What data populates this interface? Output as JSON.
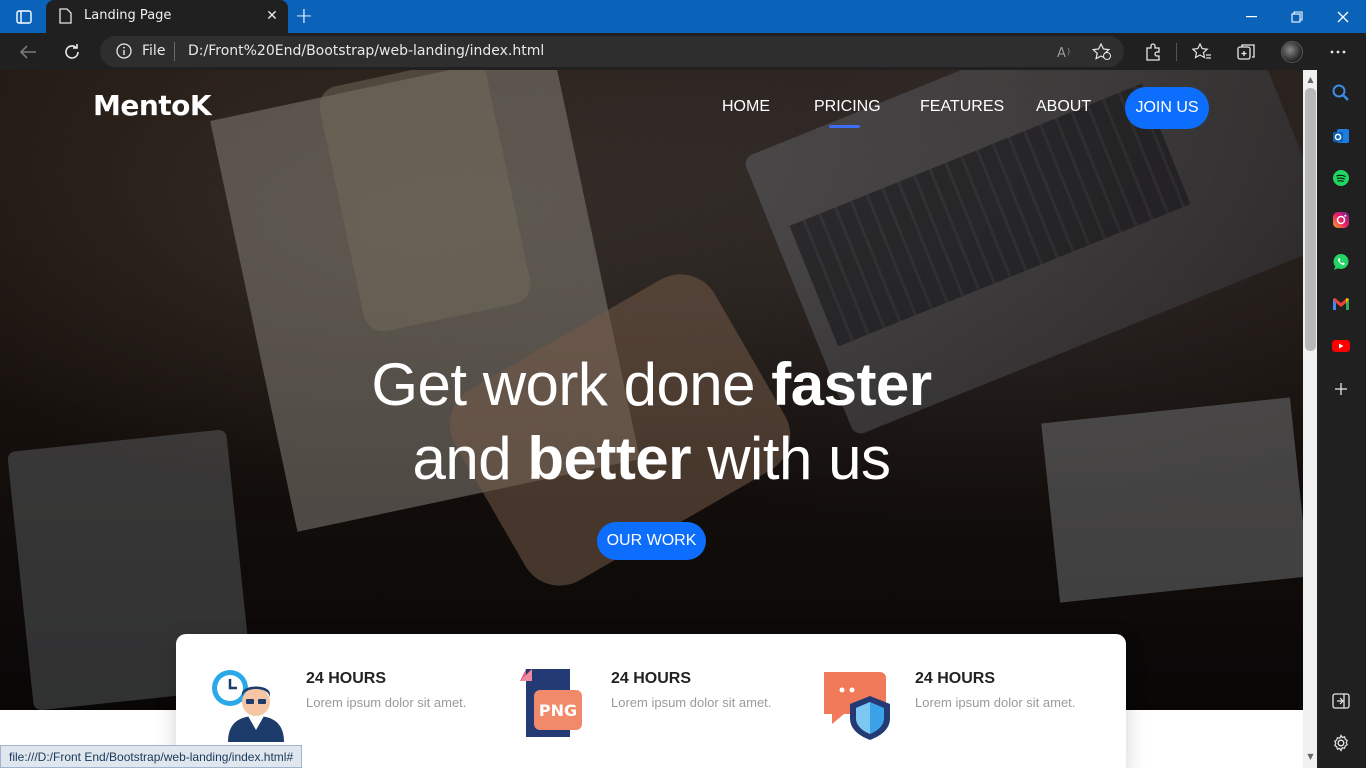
{
  "browser": {
    "tab_title": "Landing Page",
    "file_label": "File",
    "url": "D:/Front%20End/Bootstrap/web-landing/index.html",
    "status_url": "file:///D:/Front End/Bootstrap/web-landing/index.html#"
  },
  "site": {
    "logo": "MentoK",
    "nav": [
      "HOME",
      "PRICING",
      "FEATURES",
      "ABOUT"
    ],
    "active_nav": "PRICING",
    "join_label": "JOIN US",
    "headline": {
      "line1_light": "Get work done ",
      "line1_bold": "faster",
      "line2_light_a": "and ",
      "line2_bold": "better",
      "line2_light_b": " with us"
    },
    "cta_label": "OUR WORK",
    "features": [
      {
        "title": "24 HOURS",
        "text": "Lorem ipsum dolor sit amet.",
        "icon": "support-agent-icon"
      },
      {
        "title": "24 HOURS",
        "text": "Lorem ipsum dolor sit amet.",
        "icon": "png-file-icon",
        "badge": "PNG"
      },
      {
        "title": "24 HOURS",
        "text": "Lorem ipsum dolor sit amet.",
        "icon": "chat-shield-icon"
      }
    ]
  },
  "colors": {
    "accent": "#0d6efd",
    "titlebar": "#0a63b8"
  }
}
